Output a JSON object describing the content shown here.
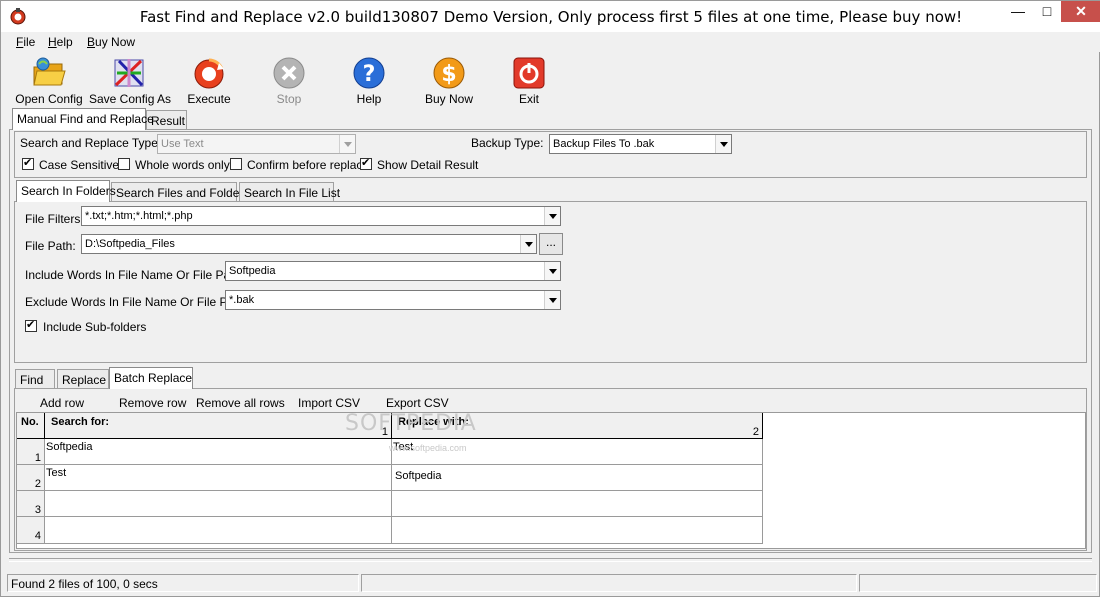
{
  "window": {
    "title": "Fast Find and Replace v2.0 build130807 Demo Version, Only process first 5 files at one time, Please buy now!",
    "controls": {
      "minimize": "—",
      "maximize": "□",
      "close": "✕"
    }
  },
  "menu": [
    {
      "label": "File",
      "accel": "F"
    },
    {
      "label": "Help",
      "accel": "H"
    },
    {
      "label": "Buy Now",
      "accel": "B"
    }
  ],
  "toolbar": [
    {
      "label": "Open Config",
      "icon": "open-folder-icon",
      "enabled": true
    },
    {
      "label": "Save Config As",
      "icon": "save-config-icon",
      "enabled": true
    },
    {
      "label": "Execute",
      "icon": "execute-icon",
      "enabled": true
    },
    {
      "label": "Stop",
      "icon": "stop-icon",
      "enabled": false
    },
    {
      "label": "Help",
      "icon": "help-icon",
      "enabled": true
    },
    {
      "label": "Buy Now",
      "icon": "buy-now-icon",
      "enabled": true
    },
    {
      "label": "Exit",
      "icon": "exit-icon",
      "enabled": true
    }
  ],
  "main_tabs": [
    "Manual Find and Replace",
    "Result"
  ],
  "options": {
    "search_type_label": "Search and Replace Type:",
    "search_type_value": "Use Text",
    "backup_type_label": "Backup Type:",
    "backup_type_value": "Backup Files To .bak",
    "checkboxes": [
      {
        "label": "Case Sensitive",
        "checked": true
      },
      {
        "label": "Whole words only",
        "checked": false
      },
      {
        "label": "Confirm before replace",
        "checked": false
      },
      {
        "label": "Show Detail Result",
        "checked": true
      }
    ]
  },
  "source_tabs": [
    "Search In Folders",
    "Search Files and Folders",
    "Search In File List"
  ],
  "folders": {
    "file_filters_label": "File Filters:",
    "file_filters_value": "*.txt;*.htm;*.html;*.php",
    "file_path_label": "File Path:",
    "file_path_value": "D:\\Softpedia_Files",
    "browse_label": "...",
    "include_label": "Include Words In File Name Or File Path:",
    "include_value": "Softpedia",
    "exclude_label": "Exclude Words In File Name Or File Path:",
    "exclude_value": "*.bak",
    "subfolders_label": "Include Sub-folders",
    "subfolders_checked": true
  },
  "mode_tabs": [
    "Find",
    "Replace",
    "Batch Replace"
  ],
  "batch": {
    "actions": [
      "Add row",
      "Remove row",
      "Remove all rows",
      "Import CSV",
      "Export CSV"
    ],
    "columns": [
      {
        "title": "No.",
        "index": ""
      },
      {
        "title": "Search for:",
        "index": "1"
      },
      {
        "title": "Replace with:",
        "index": "2"
      }
    ],
    "rows": [
      {
        "no": "1",
        "search": "Softpedia",
        "replace": "Test"
      },
      {
        "no": "2",
        "search": "Test",
        "replace": "Softpedia"
      },
      {
        "no": "3",
        "search": "",
        "replace": ""
      },
      {
        "no": "4",
        "search": "",
        "replace": ""
      }
    ]
  },
  "watermark": {
    "text": "SOFTPEDIA",
    "sub": "www.softpedia.com"
  },
  "status": [
    "Found 2 files of 100, 0 secs",
    "",
    ""
  ],
  "colors": {
    "close_button": "#c7504b",
    "window_bg": "#f0f0f0"
  }
}
